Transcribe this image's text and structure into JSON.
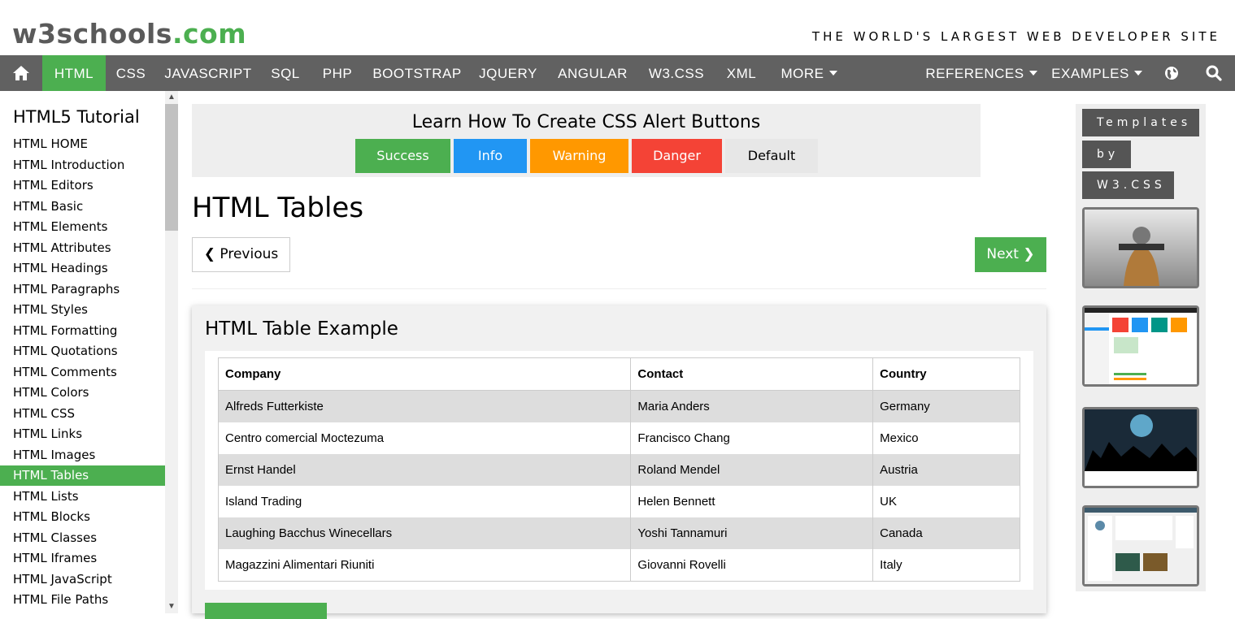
{
  "header": {
    "logo_main": "w3schools",
    "logo_domain": ".com",
    "tagline": "THE WORLD'S LARGEST WEB DEVELOPER SITE"
  },
  "nav": {
    "items": [
      "HTML",
      "CSS",
      "JAVASCRIPT",
      "SQL",
      "PHP",
      "BOOTSTRAP",
      "JQUERY",
      "ANGULAR",
      "W3.CSS",
      "XML",
      "MORE",
      "REFERENCES",
      "EXAMPLES"
    ],
    "active": "HTML",
    "icons": [
      "home-icon",
      "globe-icon",
      "search-icon"
    ]
  },
  "sidebar": {
    "title": "HTML5 Tutorial",
    "links": [
      "HTML HOME",
      "HTML Introduction",
      "HTML Editors",
      "HTML Basic",
      "HTML Elements",
      "HTML Attributes",
      "HTML Headings",
      "HTML Paragraphs",
      "HTML Styles",
      "HTML Formatting",
      "HTML Quotations",
      "HTML Comments",
      "HTML Colors",
      "HTML CSS",
      "HTML Links",
      "HTML Images",
      "HTML Tables",
      "HTML Lists",
      "HTML Blocks",
      "HTML Classes",
      "HTML Iframes",
      "HTML JavaScript",
      "HTML File Paths"
    ],
    "active": "HTML Tables"
  },
  "ad": {
    "title": "Learn How To Create CSS Alert Buttons",
    "buttons": [
      "Success",
      "Info",
      "Warning",
      "Danger",
      "Default"
    ]
  },
  "main": {
    "page_title": "HTML Tables",
    "prev_label": "❮ Previous",
    "next_label": "Next ❯",
    "example": {
      "title": "HTML Table Example",
      "headers": [
        "Company",
        "Contact",
        "Country"
      ],
      "rows": [
        [
          "Alfreds Futterkiste",
          "Maria Anders",
          "Germany"
        ],
        [
          "Centro comercial Moctezuma",
          "Francisco Chang",
          "Mexico"
        ],
        [
          "Ernst Handel",
          "Roland Mendel",
          "Austria"
        ],
        [
          "Island Trading",
          "Helen Bennett",
          "UK"
        ],
        [
          "Laughing Bacchus Winecellars",
          "Yoshi Tannamuri",
          "Canada"
        ],
        [
          "Magazzini Alimentari Riuniti",
          "Giovanni Rovelli",
          "Italy"
        ]
      ]
    }
  },
  "right_ad": {
    "tags": [
      "Templates",
      "by",
      "W3.CSS"
    ]
  },
  "colors": {
    "brand_green": "#4caf50",
    "nav_bg": "#616161",
    "info_blue": "#2196f3",
    "warning_orange": "#ff9800",
    "danger_red": "#f44336"
  }
}
